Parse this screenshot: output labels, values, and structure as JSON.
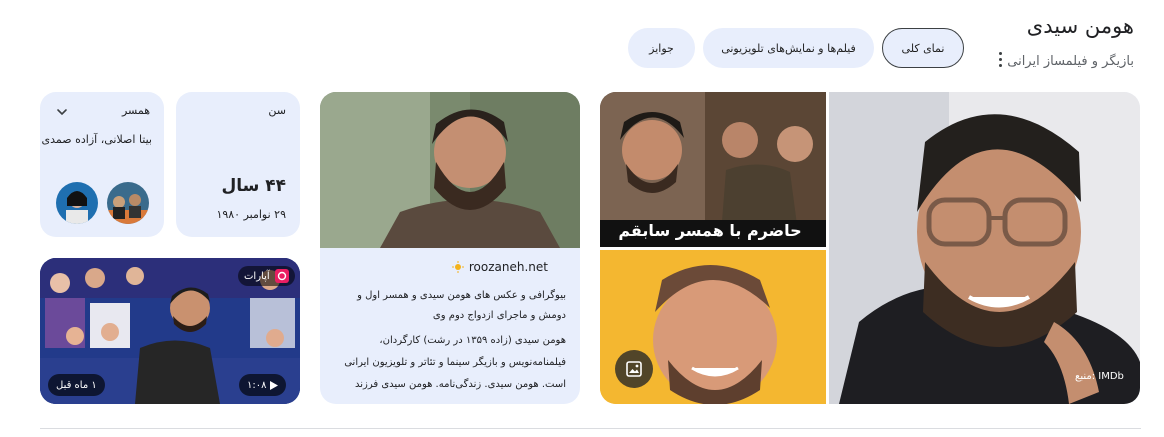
{
  "header": {
    "title": "هومن سیدی",
    "subtitle": "بازیگر و فیلمساز ایرانی",
    "more_icon": "more-vert-icon"
  },
  "tabs": [
    {
      "label": "نمای کلی",
      "active": true
    },
    {
      "label": "فیلم‌ها و نمایش‌های تلویزیونی",
      "active": false
    },
    {
      "label": "جوایز",
      "active": false
    }
  ],
  "spouse": {
    "label": "همسر",
    "names": "بیتا اصلانی، آزاده صمدی",
    "icon": "chevron-down-icon"
  },
  "age": {
    "label": "سن",
    "value": "۴۴ سال",
    "birth_date": "۲۹ نوامبر ۱۹۸۰"
  },
  "article": {
    "source": "roozaneh.net",
    "title": "بیوگرافی و عکس های هومن سیدی و همسر اول و دومش و ماجرای ازدواج دوم وی",
    "snippet_lines": [
      "هومن سیدی (زاده ۱۳۵۹ در رشت) کارگردان،",
      "فیلمنامه‌نویس و بازیگر سینما و تئاتر و تلویزیون ایرانی",
      "است. هومن سیدی. زندگی‌نامه. هومن سیدی فرزند دوم..."
    ]
  },
  "collage": {
    "caption": "حاضرم با همسر سابقم",
    "lens_icon": "image-search-icon"
  },
  "main_image": {
    "credit": "منبع: IMDb"
  },
  "video": {
    "source": "آپارات",
    "duration": "۱:۰۸",
    "age": "۱ ماه قبل",
    "play_icon": "play-icon"
  },
  "colors": {
    "card_bg": "#e8eefc",
    "text": "#202124",
    "muted": "#5f6368"
  }
}
